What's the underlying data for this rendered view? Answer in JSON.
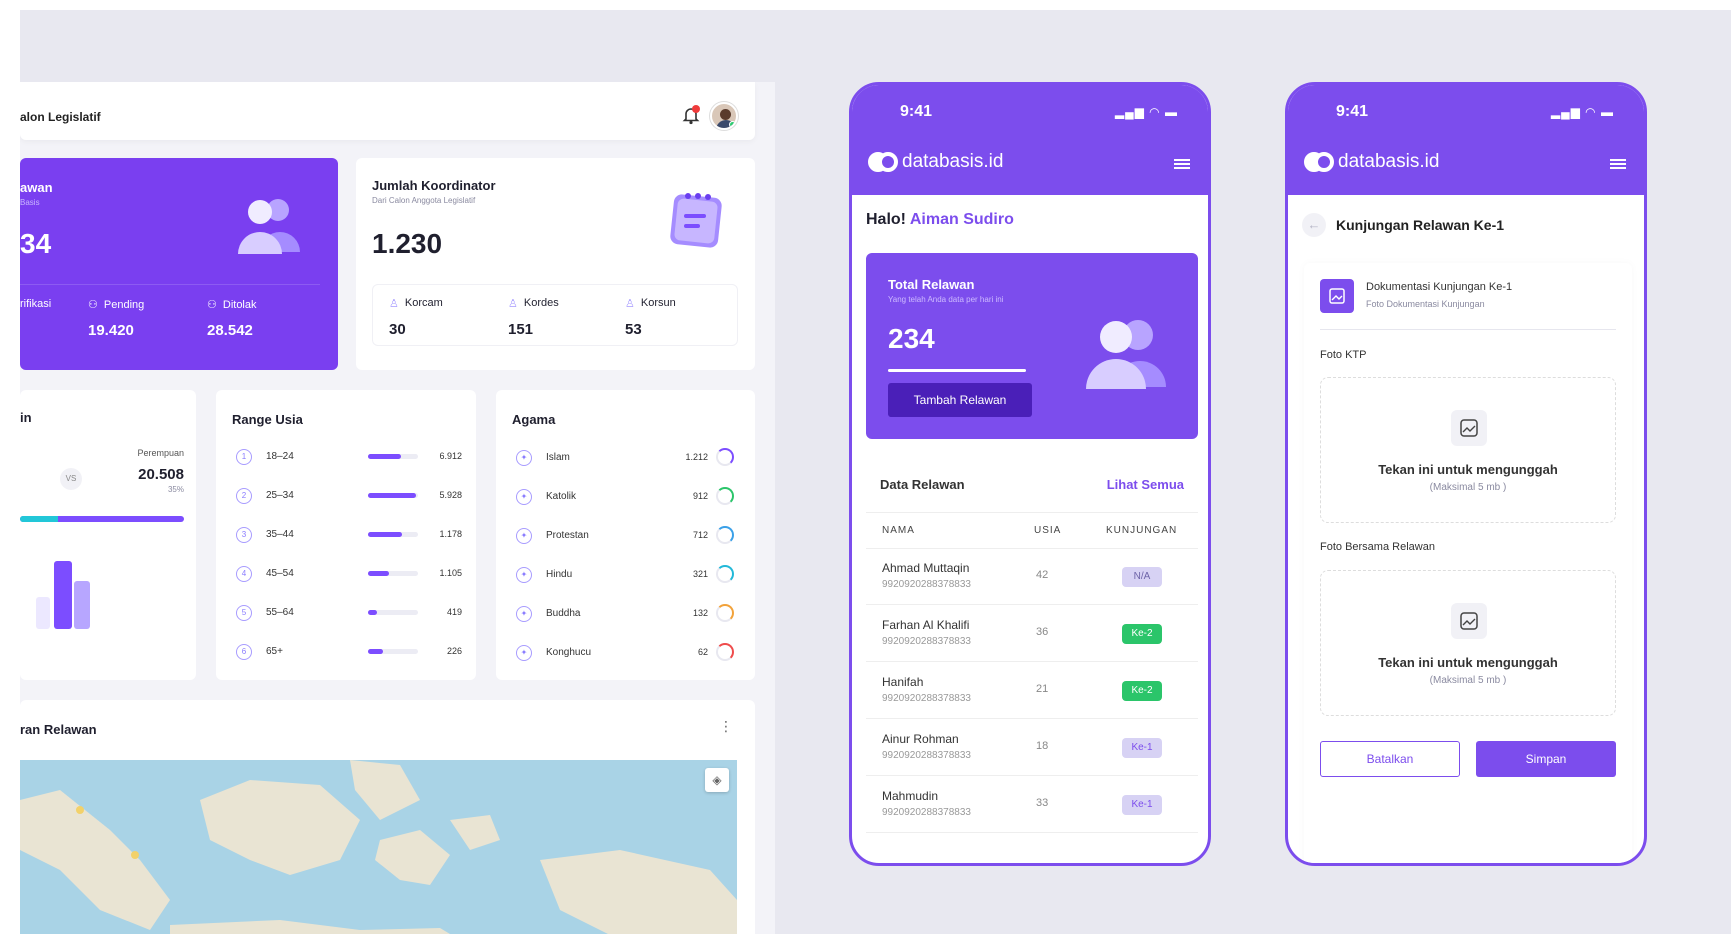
{
  "dashboard": {
    "header_title": "alon Legislatif",
    "notif_count": "1",
    "relawan_card": {
      "title": "awan",
      "subtitle": "Basis",
      "value": "34",
      "stats": [
        {
          "label": "rifikasi",
          "value": ""
        },
        {
          "label": "Pending",
          "value": "19.420"
        },
        {
          "label": "Ditolak",
          "value": "28.542"
        }
      ]
    },
    "koordinator_card": {
      "title": "Jumlah Koordinator",
      "subtitle": "Dari Calon Anggota Legislatif",
      "value": "1.230",
      "stats": [
        {
          "label": "Korcam",
          "value": "30"
        },
        {
          "label": "Kordes",
          "value": "151"
        },
        {
          "label": "Korsun",
          "value": "53"
        }
      ]
    },
    "gender_card": {
      "title": "in",
      "vs_label": "VS",
      "perempuan_label": "Perempuan",
      "perempuan_value": "20.508",
      "perempuan_pct": "35%"
    },
    "range_usia": {
      "title": "Range Usia",
      "rows": [
        {
          "n": "1",
          "label": "18–24",
          "value": "6.912",
          "fill": 0.65
        },
        {
          "n": "2",
          "label": "25–34",
          "value": "5.928",
          "fill": 0.95
        },
        {
          "n": "3",
          "label": "35–44",
          "value": "1.178",
          "fill": 0.68
        },
        {
          "n": "4",
          "label": "45–54",
          "value": "1.105",
          "fill": 0.42
        },
        {
          "n": "5",
          "label": "55–64",
          "value": "419",
          "fill": 0.18
        },
        {
          "n": "6",
          "label": "65+",
          "value": "226",
          "fill": 0.3
        }
      ]
    },
    "agama": {
      "title": "Agama",
      "rows": [
        {
          "label": "Islam",
          "value": "1.212",
          "color": "#7c4dff"
        },
        {
          "label": "Katolik",
          "value": "912",
          "color": "#2bc56a"
        },
        {
          "label": "Protestan",
          "value": "712",
          "color": "#3aa0e8"
        },
        {
          "label": "Hindu",
          "value": "321",
          "color": "#22b8d8"
        },
        {
          "label": "Buddha",
          "value": "132",
          "color": "#f2a23a"
        },
        {
          "label": "Konghucu",
          "value": "62",
          "color": "#ef4b4b"
        }
      ]
    },
    "map_card": {
      "title": "ran Relawan"
    }
  },
  "phone1": {
    "time": "9:41",
    "brand": "databasis.id",
    "greeting": "Halo!",
    "user_name": "Aiman Sudiro",
    "total_card": {
      "title": "Total Relawan",
      "subtitle": "Yang telah Anda data per hari ini",
      "value": "234",
      "button": "Tambah Relawan"
    },
    "table": {
      "title": "Data Relawan",
      "link": "Lihat Semua",
      "headers": [
        "NAMA",
        "USIA",
        "KUNJUNGAN"
      ],
      "rows": [
        {
          "name": "Ahmad Muttaqin",
          "id": "9920920288378833",
          "age": "42",
          "visit": "N/A",
          "kind": "na"
        },
        {
          "name": "Farhan Al Khalifi",
          "id": "9920920288378833",
          "age": "36",
          "visit": "Ke-2",
          "kind": "green"
        },
        {
          "name": "Hanifah",
          "id": "9920920288378833",
          "age": "21",
          "visit": "Ke-2",
          "kind": "green"
        },
        {
          "name": "Ainur Rohman",
          "id": "9920920288378833",
          "age": "18",
          "visit": "Ke-1",
          "kind": "ke1"
        },
        {
          "name": "Mahmudin",
          "id": "9920920288378833",
          "age": "33",
          "visit": "Ke-1",
          "kind": "ke1"
        }
      ]
    }
  },
  "phone2": {
    "time": "9:41",
    "brand": "databasis.id",
    "page_title": "Kunjungan Relawan Ke-1",
    "doc_title": "Dokumentasi Kunjungan Ke-1",
    "doc_subtitle": "Foto Dokumentasi Kunjungan",
    "ktp_label": "Foto KTP",
    "upload_text": "Tekan ini untuk mengunggah",
    "upload_hint": "(Maksimal 5 mb )",
    "bersama_label": "Foto Bersama Relawan",
    "cancel": "Batalkan",
    "save": "Simpan"
  },
  "colors": {
    "accent": "#7c4ded",
    "green": "#2bc56a"
  }
}
